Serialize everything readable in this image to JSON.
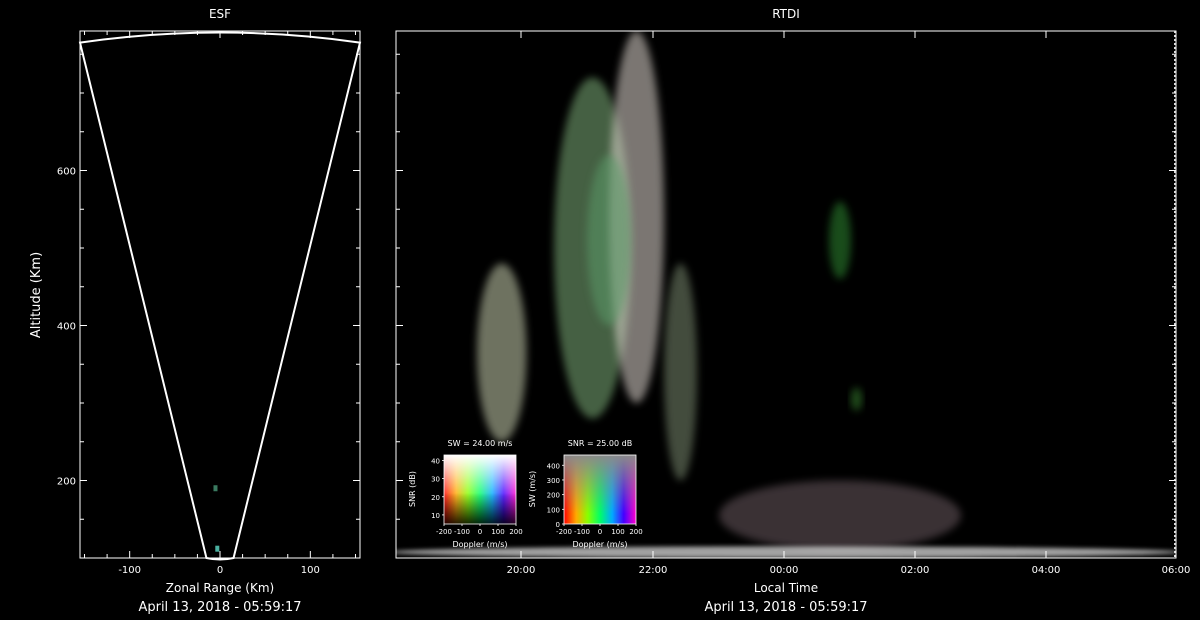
{
  "chart_data": [
    {
      "type": "scatter",
      "title": "ESF",
      "xlabel": "Zonal Range (Km)",
      "ylabel": "Altitude (Km)",
      "xlim": [
        -155,
        155
      ],
      "ylim": [
        100,
        780
      ],
      "xticks": [
        -100,
        0,
        100
      ],
      "yticks": [
        200,
        400,
        600
      ],
      "date_label": "April 13, 2018 - 05:59:17",
      "beam_outline": {
        "left_edge": [
          [
            -15,
            100
          ],
          [
            -155,
            765
          ]
        ],
        "right_edge": [
          [
            15,
            100
          ],
          [
            155,
            765
          ]
        ],
        "top_arc_apex": [
          0,
          778
        ]
      },
      "echo_points": [
        {
          "x": -3,
          "y": 112,
          "color": "#4ab0a0"
        },
        {
          "x": -5,
          "y": 190,
          "color": "#3a7a60"
        }
      ]
    },
    {
      "type": "heatmap",
      "title": "RTDI",
      "xlabel": "Local Time",
      "xtick_labels": [
        "20:00",
        "22:00",
        "00:00",
        "02:00",
        "04:00",
        "06:00"
      ],
      "ylim": [
        100,
        780
      ],
      "date_label": "April 13, 2018 - 05:59:17",
      "description": "",
      "echo_regions": [
        {
          "t0": "19:20",
          "t1": "20:05",
          "alt0": 250,
          "alt1": 480,
          "color": "#c9d0b0"
        },
        {
          "t0": "20:30",
          "t1": "21:40",
          "alt0": 280,
          "alt1": 720,
          "color": "#7fb07a"
        },
        {
          "t0": "21:20",
          "t1": "22:10",
          "alt0": 300,
          "alt1": 780,
          "color": "#e0d8d0"
        },
        {
          "t0": "21:00",
          "t1": "21:40",
          "alt0": 400,
          "alt1": 620,
          "color": "#5a9a68"
        },
        {
          "t0": "22:10",
          "t1": "22:40",
          "alt0": 200,
          "alt1": 480,
          "color": "#7a8a70"
        },
        {
          "t0": "00:40",
          "t1": "01:00",
          "alt0": 460,
          "alt1": 560,
          "color": "#2e8a30"
        },
        {
          "t0": "01:00",
          "t1": "01:10",
          "alt0": 290,
          "alt1": 320,
          "color": "#3a8a30"
        },
        {
          "t0": "23:00",
          "t1": "02:40",
          "alt0": 110,
          "alt1": 200,
          "color": "#6a5a60"
        },
        {
          "t0": "18:00",
          "t1": "06:00",
          "alt0": 100,
          "alt1": 115,
          "color": "#d8d8d8"
        }
      ],
      "legends": [
        {
          "title": "SW = 24.00 m/s",
          "xlabel": "Doppler (m/s)",
          "ylabel": "SNR (dB)",
          "xtick_labels": [
            "-200",
            "-100",
            "0",
            "100",
            "200"
          ],
          "ytick_labels": [
            "10",
            "20",
            "30",
            "40"
          ],
          "xlim": [
            -200,
            200
          ],
          "ylim": [
            5,
            43
          ]
        },
        {
          "title": "SNR = 25.00 dB",
          "xlabel": "Doppler (m/s)",
          "ylabel": "SW (m/s)",
          "xtick_labels": [
            "-200",
            "-100",
            "0",
            "100",
            "200"
          ],
          "ytick_labels": [
            "0",
            "100",
            "200",
            "300",
            "400"
          ],
          "xlim": [
            -200,
            200
          ],
          "ylim": [
            0,
            470
          ]
        }
      ]
    }
  ],
  "colors": {
    "background": "#000000",
    "axes": "#ffffff",
    "text": "#ffffff"
  }
}
